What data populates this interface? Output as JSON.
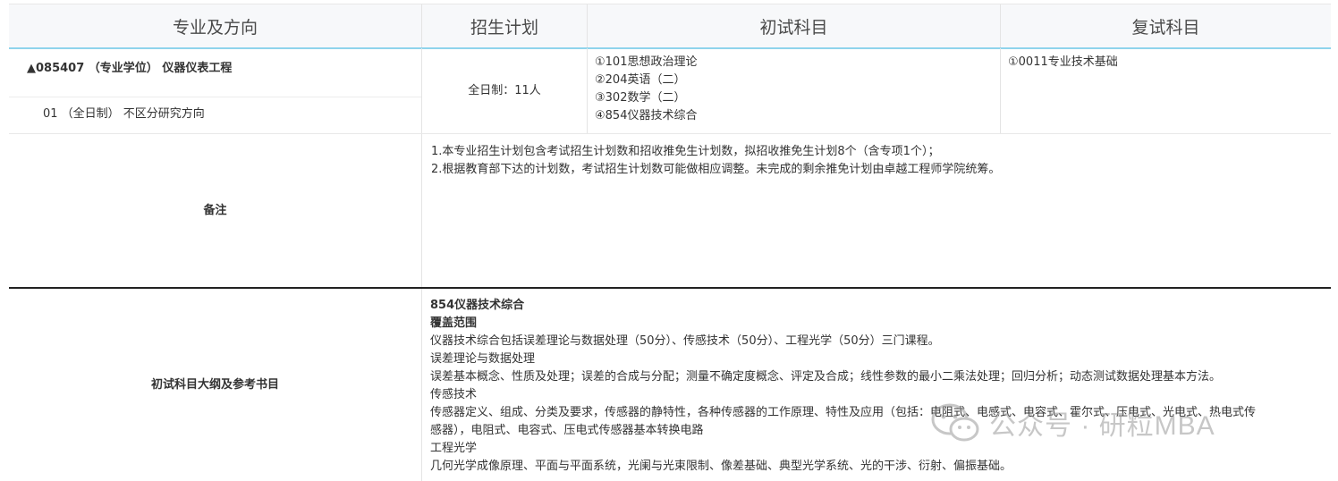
{
  "header": {
    "col1": "专业及方向",
    "col2": "招生计划",
    "col3": "初试科目",
    "col4": "复试科目"
  },
  "program": {
    "title": "▲085407 （专业学位） 仪器仪表工程",
    "direction": "01 （全日制） 不区分研究方向",
    "plan": "全日制：11人",
    "exam_subjects": [
      "①101思想政治理论",
      "②204英语（二）",
      "③302数学（二）",
      "④854仪器技术综合"
    ],
    "retest_subjects": [
      "①0011专业技术基础"
    ]
  },
  "remarks": {
    "label": "备注",
    "lines": [
      "1.本专业招生计划包含考试招生计划数和招收推免生计划数，拟招收推免生计划8个（含专项1个）；",
      "2.根据教育部下达的计划数，考试招生计划数可能做相应调整。未完成的剩余推免计划由卓越工程师学院统筹。"
    ]
  },
  "syllabus": {
    "label": "初试科目大纲及参考书目",
    "title": "854仪器技术综合",
    "coverage_heading": "覆盖范围",
    "lines": [
      "仪器技术综合包括误差理论与数据处理（50分）、传感技术（50分）、工程光学（50分）三门课程。",
      "误差理论与数据处理",
      "误差基本概念、性质及处理；误差的合成与分配；测量不确定度概念、评定及合成；线性参数的最小二乘法处理；回归分析；动态测试数据处理基本方法。",
      "传感技术",
      "传感器定义、组成、分类及要求，传感器的静特性，各种传感器的工作原理、特性及应用（包括：电阻式、电感式、电容式、霍尔式、压电式、光电式、热电式传",
      "感器），电阻式、电容式、压电式传感器基本转换电路",
      "工程光学",
      "几何光学成像原理、平面与平面系统，光阑与光束限制、像差基础、典型光学系统、光的干涉、衍射、偏振基础。"
    ]
  },
  "watermark": {
    "text": "公众号 · 研粒MBA",
    "icon": "wechat-icon"
  }
}
